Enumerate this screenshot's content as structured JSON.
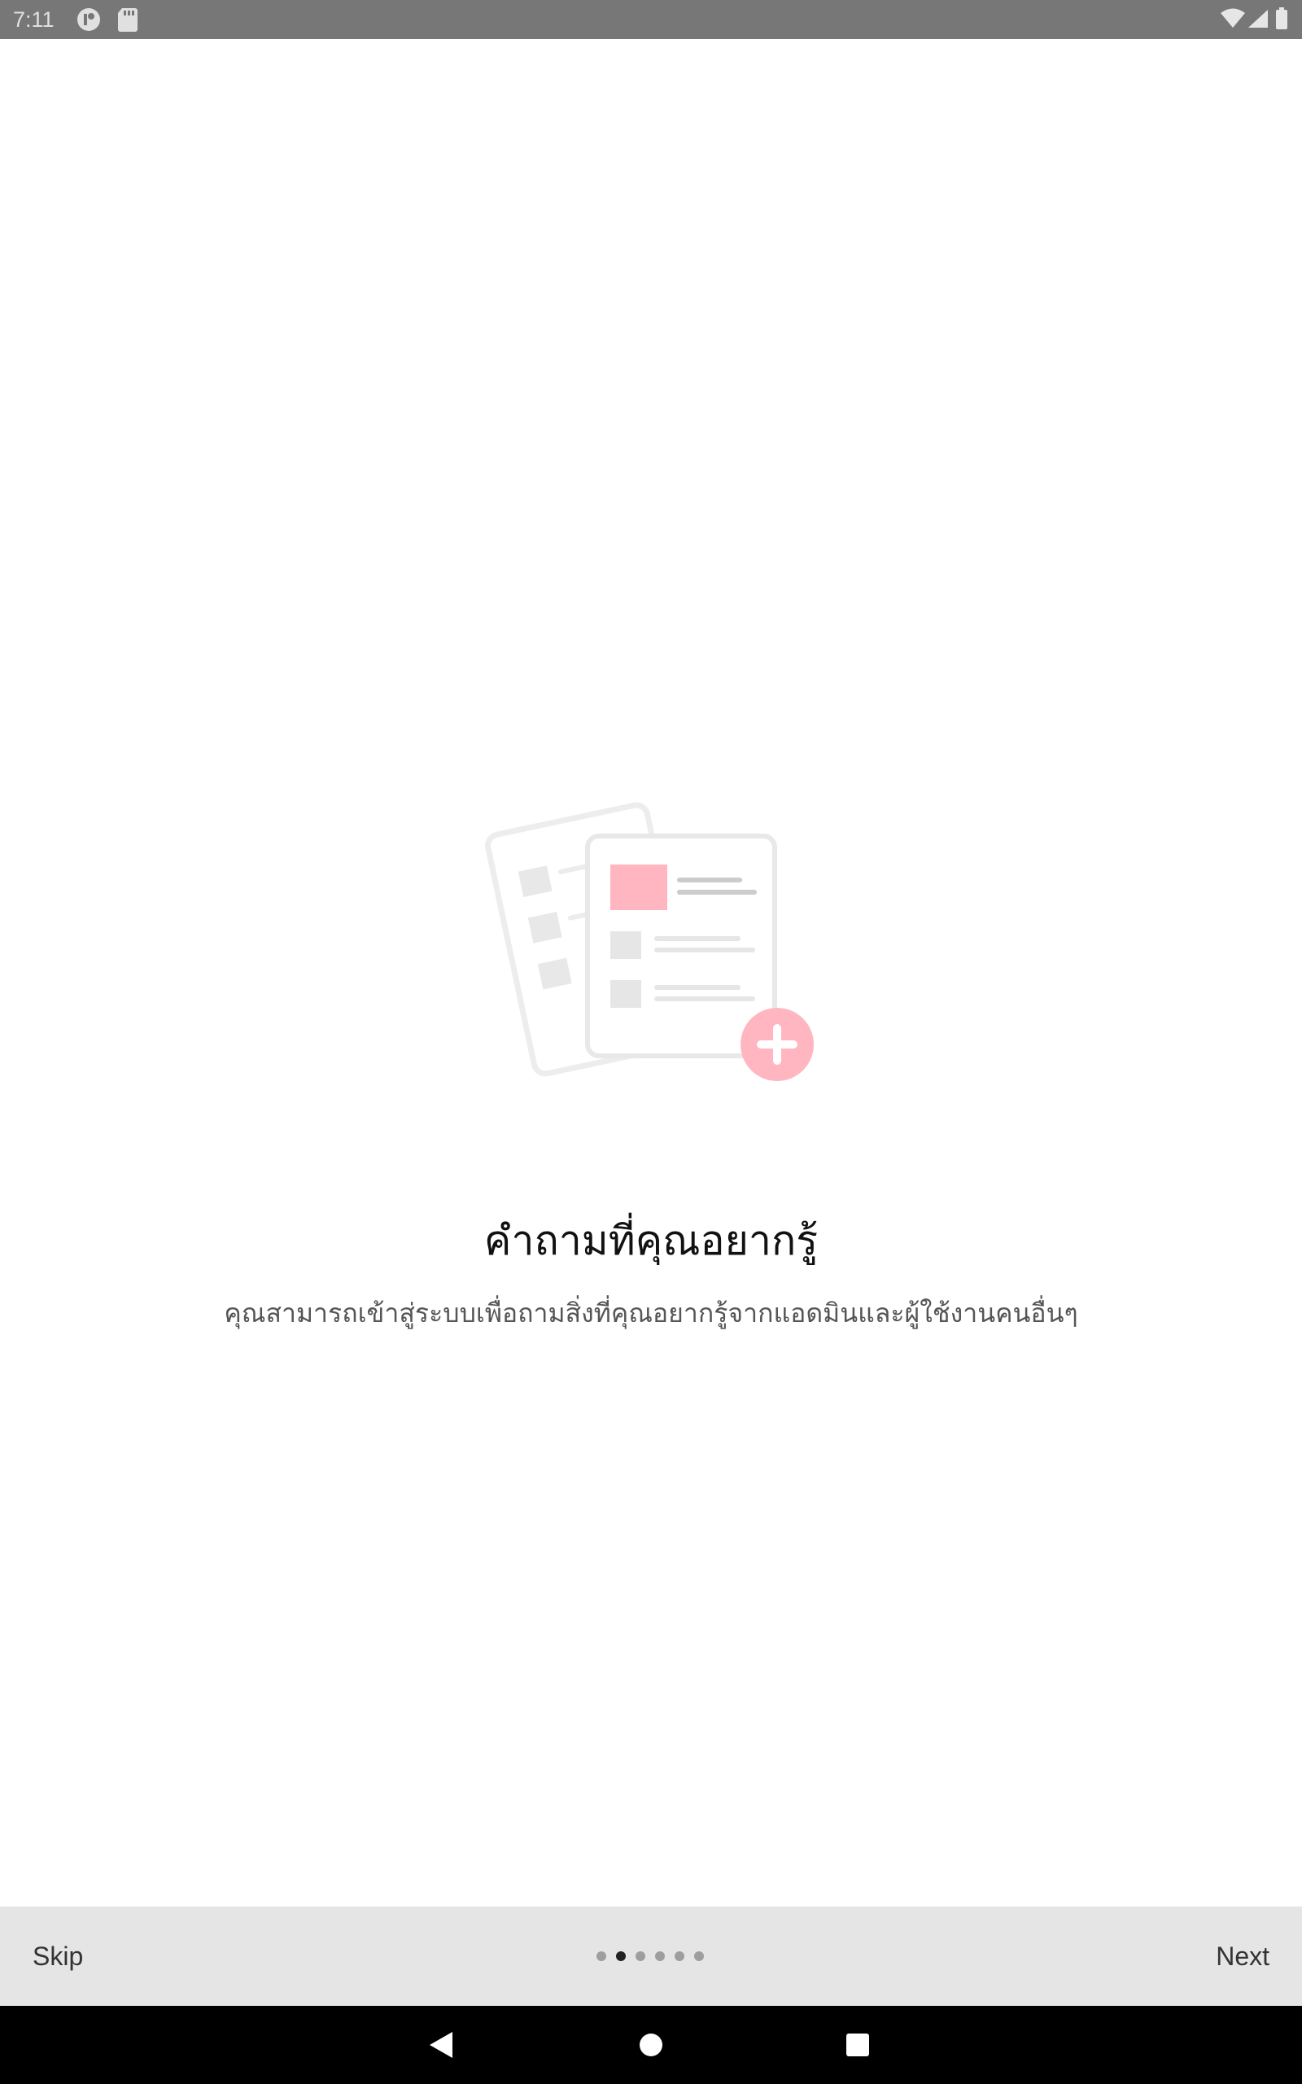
{
  "status_bar": {
    "time": "7:11",
    "icons": [
      "app-icon",
      "sd-card-icon",
      "wifi-icon",
      "signal-icon",
      "battery-icon"
    ]
  },
  "onboarding": {
    "title": "คำถามที่คุณอยากรู้",
    "subtitle": "คุณสามารถเข้าสู่ระบบเพื่อถามสิ่งที่คุณอยากรู้จากแอดมินและผู้ใช้งานคนอื่นๆ",
    "illustration": "documents-add-icon",
    "accent_color": "#ffb6c1"
  },
  "bottom_bar": {
    "skip_label": "Skip",
    "next_label": "Next",
    "page_count": 6,
    "current_page": 2
  },
  "nav_bar": {
    "icons": [
      "back-icon",
      "home-icon",
      "recents-icon"
    ]
  }
}
